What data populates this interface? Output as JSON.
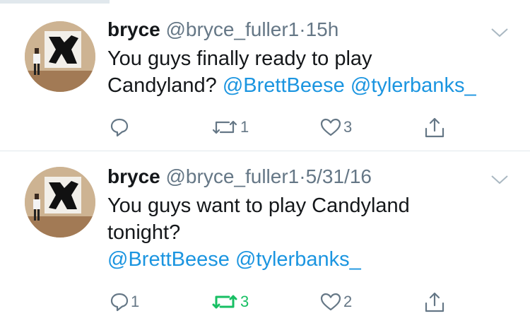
{
  "tweets": [
    {
      "name": "bryce",
      "handle": "@bryce_fuller1",
      "separator": "·",
      "time": "15h",
      "text_line1": "You guys finally ready to play",
      "text_line2_prefix": "Candyland? ",
      "mention1": "@BrettBeese",
      "mention2": "@tylerbanks_",
      "reply_count": "",
      "retweet_count": "1",
      "like_count": "3",
      "retweeted": false
    },
    {
      "name": "bryce",
      "handle": "@bryce_fuller1",
      "separator": "·",
      "time": "5/31/16",
      "text_line1": "You guys want to play Candyland",
      "text_line2": "tonight?",
      "mention1": "@BrettBeese",
      "mention2": "@tylerbanks_",
      "reply_count": "1",
      "retweet_count": "3",
      "like_count": "2",
      "retweeted": true
    }
  ],
  "icons": {
    "reply": "reply-icon",
    "retweet": "retweet-icon",
    "like": "heart-icon",
    "share": "share-icon",
    "menu": "chevron-down-icon"
  },
  "colors": {
    "text": "#14171a",
    "secondary": "#657786",
    "link": "#1b95e0",
    "retweet_active": "#17bf63",
    "divider": "#e1e8ed"
  }
}
